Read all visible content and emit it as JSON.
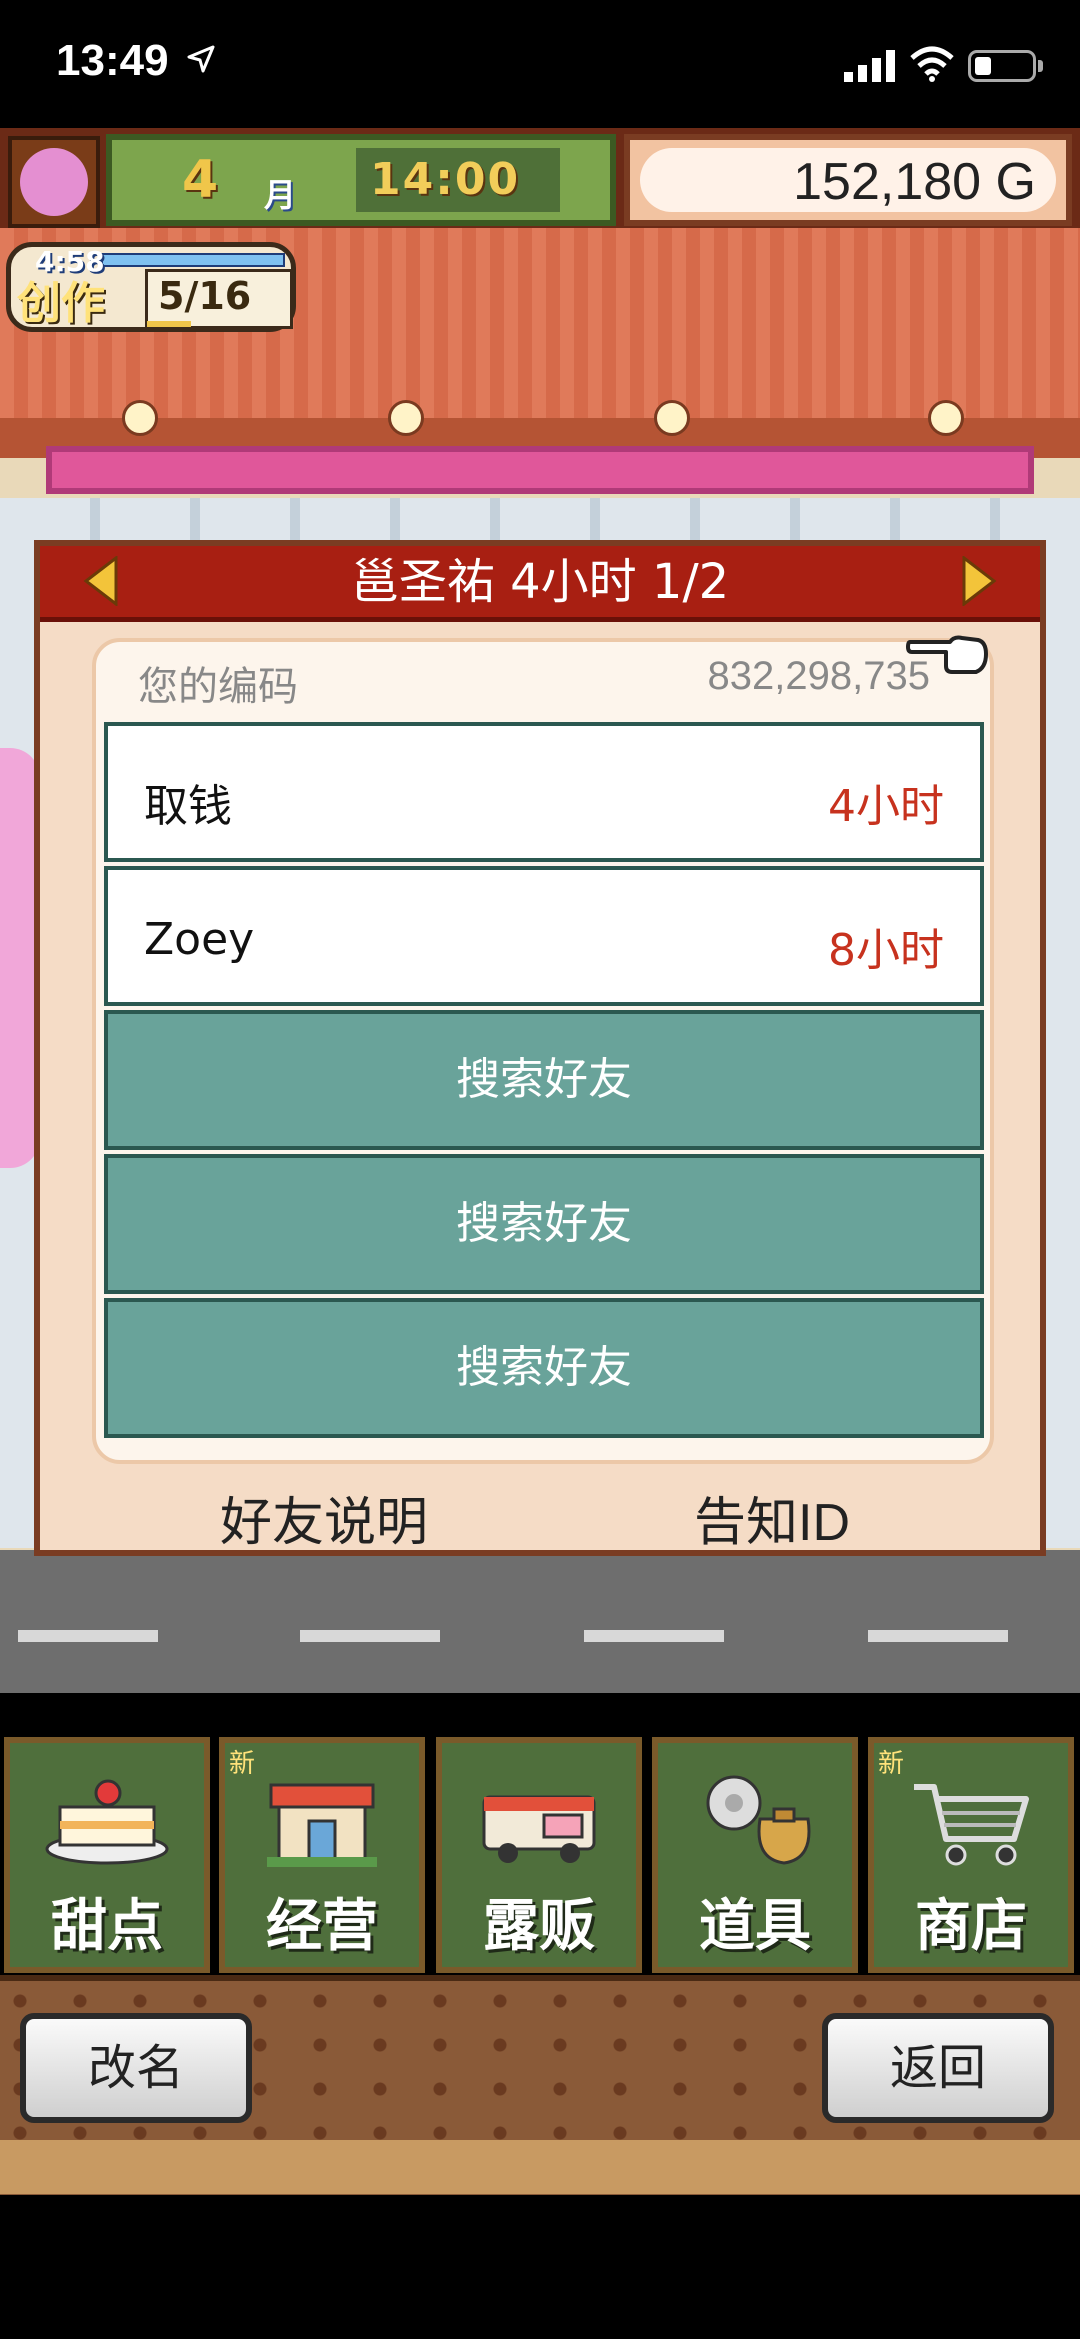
{
  "status_bar": {
    "time": "13:49",
    "location_icon": "location-arrow-icon",
    "signal_icon": "cell-signal-icon",
    "wifi_icon": "wifi-icon",
    "battery_icon": "battery-icon"
  },
  "hud": {
    "month_number": "4",
    "month_label": "月",
    "time": "14:00",
    "money": "152,180 G",
    "create": {
      "timer": "4:58",
      "label": "创作",
      "count": "5/16"
    }
  },
  "dialog": {
    "title": "邕圣祐  4小时 1/2",
    "code_label": "您的编码",
    "code_value": "832,298,735",
    "friends": [
      {
        "name": "取钱",
        "time": "4小时"
      },
      {
        "name": "Zoey",
        "time": "8小时"
      }
    ],
    "empty_slots": [
      "搜索好友",
      "搜索好友",
      "搜索好友"
    ],
    "friend_help": "好友说明",
    "notify_id": "告知ID"
  },
  "nav": {
    "items": [
      {
        "label": "甜点",
        "is_new": false,
        "icon": "cake-icon"
      },
      {
        "label": "经营",
        "is_new": true,
        "new_label": "新",
        "icon": "shop-icon"
      },
      {
        "label": "露贩",
        "is_new": false,
        "icon": "food-truck-icon"
      },
      {
        "label": "道具",
        "is_new": false,
        "icon": "items-bag-icon"
      },
      {
        "label": "商店",
        "is_new": true,
        "new_label": "新",
        "icon": "shopping-cart-icon"
      }
    ]
  },
  "bottom_buttons": {
    "rename": "改名",
    "back": "返回"
  },
  "colors": {
    "dialog_header": "#a81f12",
    "friend_time": "#c7321e",
    "empty_slot": "#69a39a",
    "nav_button": "#4f6f3c"
  }
}
